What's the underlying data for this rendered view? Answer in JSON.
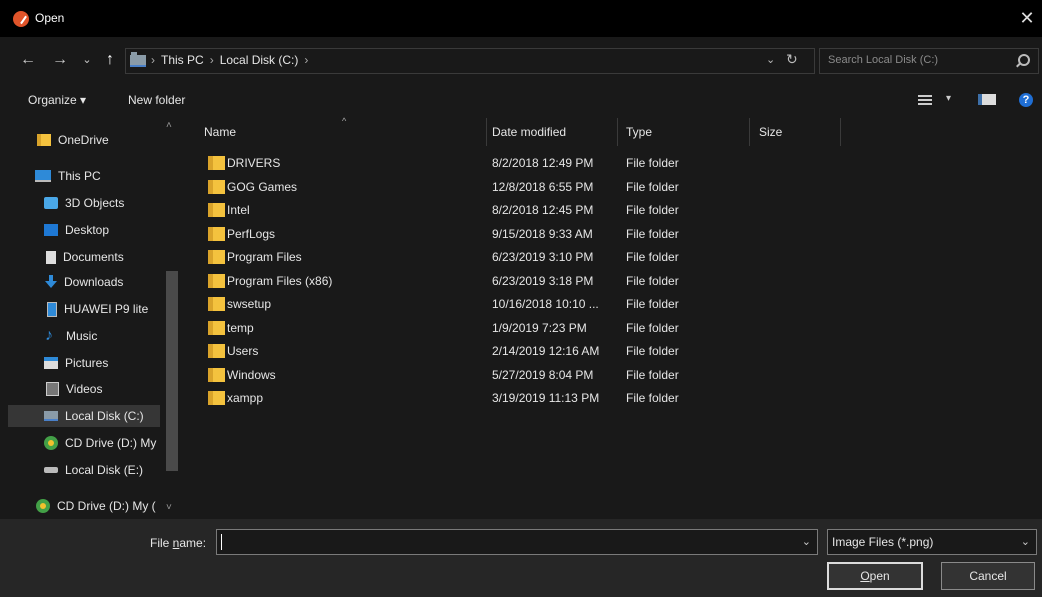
{
  "window": {
    "title": "Open",
    "close": "✕"
  },
  "nav": {
    "back": "←",
    "forward": "→",
    "recent": "⌄",
    "up": "↑",
    "breadcrumbs": [
      "This PC",
      "Local Disk (C:)"
    ],
    "separator": "›",
    "address_dropdown": "⌄",
    "refresh": "↻",
    "search_placeholder": "Search Local Disk (C:)"
  },
  "toolbar": {
    "organize": "Organize ▾",
    "new_folder": "New folder",
    "view_caret": "▾",
    "help": "?"
  },
  "sidebar": {
    "items": [
      {
        "label": "OneDrive",
        "icon": "onedrive-folder-icon"
      },
      {
        "label": "This PC",
        "icon": "pc-icon"
      },
      {
        "label": "3D Objects",
        "icon": "3d-objects-icon"
      },
      {
        "label": "Desktop",
        "icon": "desktop-icon"
      },
      {
        "label": "Documents",
        "icon": "documents-icon"
      },
      {
        "label": "Downloads",
        "icon": "downloads-icon"
      },
      {
        "label": "HUAWEI P9 lite",
        "icon": "phone-icon"
      },
      {
        "label": "Music",
        "icon": "music-icon"
      },
      {
        "label": "Pictures",
        "icon": "pictures-icon"
      },
      {
        "label": "Videos",
        "icon": "videos-icon"
      },
      {
        "label": "Local Disk (C:)",
        "icon": "local-disk-icon",
        "selected": true
      },
      {
        "label": "CD Drive (D:) My",
        "icon": "cd-drive-icon"
      },
      {
        "label": "Local Disk (E:)",
        "icon": "local-disk-icon"
      },
      {
        "label": "CD Drive (D:) My (",
        "icon": "cd-drive-icon"
      }
    ],
    "scroll_up": "˄",
    "scroll_down": "˅"
  },
  "columns": {
    "name": "Name",
    "date": "Date modified",
    "type": "Type",
    "size": "Size",
    "sort_indicator": "^"
  },
  "files": [
    {
      "name": "DRIVERS",
      "date": "8/2/2018 12:49 PM",
      "type": "File folder"
    },
    {
      "name": "GOG Games",
      "date": "12/8/2018 6:55 PM",
      "type": "File folder"
    },
    {
      "name": "Intel",
      "date": "8/2/2018 12:45 PM",
      "type": "File folder"
    },
    {
      "name": "PerfLogs",
      "date": "9/15/2018 9:33 AM",
      "type": "File folder"
    },
    {
      "name": "Program Files",
      "date": "6/23/2019 3:10 PM",
      "type": "File folder"
    },
    {
      "name": "Program Files (x86)",
      "date": "6/23/2019 3:18 PM",
      "type": "File folder"
    },
    {
      "name": "swsetup",
      "date": "10/16/2018 10:10 ...",
      "type": "File folder"
    },
    {
      "name": "temp",
      "date": "1/9/2019 7:23 PM",
      "type": "File folder"
    },
    {
      "name": "Users",
      "date": "2/14/2019 12:16 AM",
      "type": "File folder"
    },
    {
      "name": "Windows",
      "date": "5/27/2019 8:04 PM",
      "type": "File folder"
    },
    {
      "name": "xampp",
      "date": "3/19/2019 11:13 PM",
      "type": "File folder"
    }
  ],
  "bottom": {
    "file_name_label_pre": "File ",
    "file_name_label_ul": "n",
    "file_name_label_post": "ame:",
    "file_name_value": "",
    "file_dropdown": "⌄",
    "file_type": "Image Files (*.png)",
    "type_dropdown": "⌄",
    "open_ul": "O",
    "open_rest": "pen",
    "cancel": "Cancel"
  }
}
